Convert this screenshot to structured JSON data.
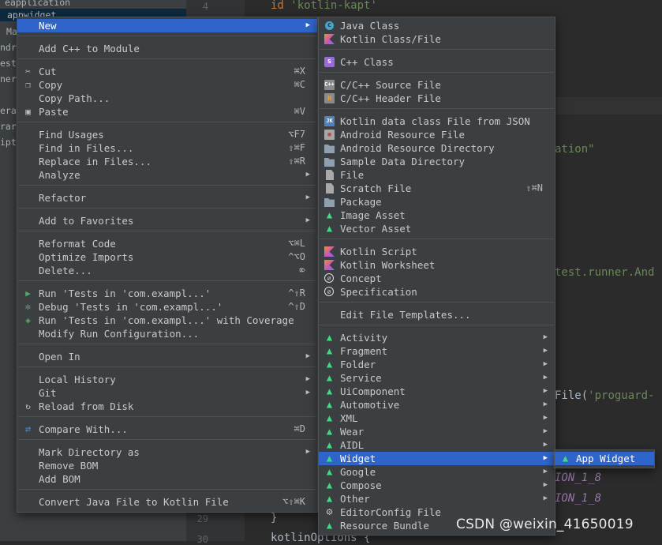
{
  "project_tree": {
    "items": [
      "eapplication",
      "appwidget",
      "Ma",
      "ndr",
      "est",
      "ner",
      "era",
      "rar",
      "ipt"
    ]
  },
  "editor": {
    "line_numbers": {
      "top": "4",
      "l29": "29",
      "l30": "30"
    },
    "code": {
      "line1_kw": "id",
      "line1_str": "'kotlin-kapt'",
      "frag_ation": "ation\"",
      "frag_runner": "test.runner.And",
      "frag_file_a": "File(",
      "frag_file_b": "'proguard-",
      "frag_ion1": "ION_1_8",
      "frag_ion2": "ION_1_8",
      "brace": "}",
      "kotlin_options": "kotlinOptions {"
    }
  },
  "watermark": "CSDN @weixin_41650019",
  "context_menu": {
    "items": [
      {
        "label": "New",
        "shortcut": "",
        "submenu": true,
        "selected": true
      },
      {
        "label": "Add C++ to Module"
      },
      {
        "label": "Cut",
        "shortcut": "⌘X"
      },
      {
        "label": "Copy",
        "shortcut": "⌘C"
      },
      {
        "label": "Copy Path..."
      },
      {
        "label": "Paste",
        "shortcut": "⌘V"
      },
      {
        "label": "Find Usages",
        "shortcut": "⌥F7"
      },
      {
        "label": "Find in Files...",
        "shortcut": "⇧⌘F"
      },
      {
        "label": "Replace in Files...",
        "shortcut": "⇧⌘R"
      },
      {
        "label": "Analyze",
        "submenu": true
      },
      {
        "label": "Refactor",
        "submenu": true
      },
      {
        "label": "Add to Favorites",
        "submenu": true
      },
      {
        "label": "Reformat Code",
        "shortcut": "⌥⌘L"
      },
      {
        "label": "Optimize Imports",
        "shortcut": "^⌥O"
      },
      {
        "label": "Delete...",
        "shortcut": "⌦"
      },
      {
        "label": "Run 'Tests in 'com.exampl...'",
        "shortcut": "^⇧R"
      },
      {
        "label": "Debug 'Tests in 'com.exampl...'",
        "shortcut": "^⇧D"
      },
      {
        "label": "Run 'Tests in 'com.exampl...' with Coverage"
      },
      {
        "label": "Modify Run Configuration..."
      },
      {
        "label": "Open In",
        "submenu": true
      },
      {
        "label": "Local History",
        "submenu": true
      },
      {
        "label": "Git",
        "submenu": true
      },
      {
        "label": "Reload from Disk"
      },
      {
        "label": "Compare With...",
        "shortcut": "⌘D"
      },
      {
        "label": "Mark Directory as",
        "submenu": true
      },
      {
        "label": "Remove BOM"
      },
      {
        "label": "Add BOM"
      },
      {
        "label": "Convert Java File to Kotlin File",
        "shortcut": "⌥⇧⌘K"
      }
    ]
  },
  "new_submenu": {
    "items": [
      {
        "label": "Java Class",
        "icon": "java-class-icon"
      },
      {
        "label": "Kotlin Class/File",
        "icon": "kotlin-icon"
      },
      {
        "label": "C++ Class",
        "icon": "cpp-class-icon"
      },
      {
        "label": "C/C++ Source File",
        "icon": "c-source-file-icon"
      },
      {
        "label": "C/C++ Header File",
        "icon": "c-header-file-icon"
      },
      {
        "label": "Kotlin data class File from JSON",
        "icon": "json-icon"
      },
      {
        "label": "Android Resource File",
        "icon": "resource-file-icon"
      },
      {
        "label": "Android Resource Directory",
        "icon": "folder-icon"
      },
      {
        "label": "Sample Data Directory",
        "icon": "folder-icon"
      },
      {
        "label": "File",
        "icon": "file-icon"
      },
      {
        "label": "Scratch File",
        "shortcut": "⇧⌘N",
        "icon": "scratch-file-icon"
      },
      {
        "label": "Package",
        "icon": "package-icon"
      },
      {
        "label": "Image Asset",
        "icon": "android-icon"
      },
      {
        "label": "Vector Asset",
        "icon": "android-icon"
      },
      {
        "label": "Kotlin Script",
        "icon": "kotlin-script-icon"
      },
      {
        "label": "Kotlin Worksheet",
        "icon": "kotlin-worksheet-icon"
      },
      {
        "label": "Concept",
        "icon": "concept-icon"
      },
      {
        "label": "Specification",
        "icon": "specification-icon"
      },
      {
        "label": "Edit File Templates..."
      },
      {
        "label": "Activity",
        "submenu": true,
        "icon": "android-icon"
      },
      {
        "label": "Fragment",
        "submenu": true,
        "icon": "android-icon"
      },
      {
        "label": "Folder",
        "submenu": true,
        "icon": "android-icon"
      },
      {
        "label": "Service",
        "submenu": true,
        "icon": "android-icon"
      },
      {
        "label": "UiComponent",
        "submenu": true,
        "icon": "android-icon"
      },
      {
        "label": "Automotive",
        "submenu": true,
        "icon": "android-icon"
      },
      {
        "label": "XML",
        "submenu": true,
        "icon": "android-icon"
      },
      {
        "label": "Wear",
        "submenu": true,
        "icon": "android-icon"
      },
      {
        "label": "AIDL",
        "submenu": true,
        "icon": "android-icon"
      },
      {
        "label": "Widget",
        "submenu": true,
        "selected": true,
        "icon": "android-icon"
      },
      {
        "label": "Google",
        "submenu": true,
        "icon": "android-icon"
      },
      {
        "label": "Compose",
        "submenu": true,
        "icon": "android-icon"
      },
      {
        "label": "Other",
        "submenu": true,
        "icon": "android-icon"
      },
      {
        "label": "EditorConfig File",
        "icon": "gear-icon"
      },
      {
        "label": "Resource Bundle",
        "icon": "android-icon"
      }
    ]
  },
  "widget_submenu": {
    "items": [
      {
        "label": "App Widget",
        "icon": "android-icon"
      }
    ]
  },
  "colors": {
    "selection": "#2f65ca",
    "menu_bg": "#3c3f41",
    "android_green": "#3ddc84"
  }
}
